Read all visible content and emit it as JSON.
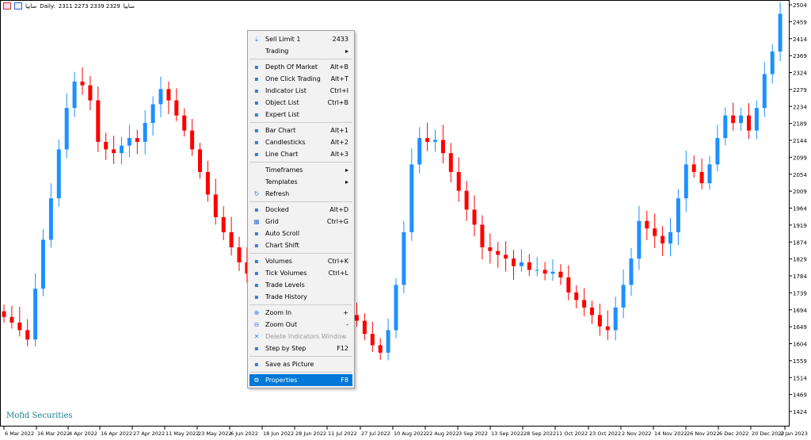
{
  "header": {
    "symbol": "سایپا",
    "timeframe": "Daily:",
    "ohlc": "2311 2273 2339 2329",
    "desc": "سایپا"
  },
  "watermark": "Mofid Securities",
  "colors": {
    "bull": "#1e90ff",
    "bear": "#ff0000",
    "menu_highlight": "#0078d7"
  },
  "y_axis": {
    "ticks": [
      "2504",
      "2459",
      "2414",
      "2369",
      "2324",
      "2279",
      "2234",
      "2189",
      "2144",
      "2099",
      "2054",
      "2009",
      "1964",
      "1919",
      "1874",
      "1829",
      "1784",
      "1739",
      "1694",
      "1649",
      "1604",
      "1559",
      "1514",
      "1469",
      "1424"
    ]
  },
  "x_axis": {
    "ticks": [
      "6 Mar 2022",
      "16 Mar 2022",
      "4 Apr 2022",
      "16 Apr 2022",
      "27 Apr 2022",
      "11 May 2022",
      "23 May 2022",
      "6 Jun 2022",
      "18 Jun 2022",
      "28 Jun 2022",
      "11 Jul 2022",
      "27 Jul 2022",
      "10 Aug 2022",
      "22 Aug 2022",
      "3 Sep 2022",
      "13 Sep 2022",
      "28 Sep 2022",
      "11 Oct 2022",
      "23 Oct 2022",
      "2 Nov 2022",
      "14 Nov 2022",
      "26 Nov 2022",
      "6 Dec 2022",
      "20 Dec 2022",
      "2 Jan 2023"
    ]
  },
  "chart_data": {
    "type": "candlestick",
    "closes": [
      1675,
      1660,
      1640,
      1615,
      1750,
      1880,
      1990,
      2120,
      2230,
      2300,
      2290,
      2250,
      2140,
      2120,
      2110,
      2130,
      2150,
      2140,
      2190,
      2240,
      2280,
      2250,
      2210,
      2170,
      2120,
      2060,
      2000,
      1940,
      1900,
      1860,
      1820,
      1790,
      1780,
      1770,
      1760,
      1750,
      1740,
      1730,
      1720,
      1710,
      1700,
      1700,
      1690,
      1690,
      1680,
      1665,
      1630,
      1600,
      1580,
      1640,
      1760,
      1900,
      2080,
      2150,
      2140,
      2145,
      2110,
      2060,
      2010,
      1960,
      1920,
      1860,
      1850,
      1840,
      1830,
      1810,
      1820,
      1800,
      1800,
      1790,
      1795,
      1780,
      1740,
      1720,
      1700,
      1680,
      1650,
      1640,
      1700,
      1760,
      1830,
      1930,
      1910,
      1890,
      1870,
      1900,
      1990,
      2080,
      2060,
      2030,
      2080,
      2150,
      2210,
      2190,
      2210,
      2170,
      2230,
      2320,
      2380,
      2480
    ],
    "ylim": [
      1424,
      2504
    ]
  },
  "menu": {
    "items": [
      {
        "label": "Sell Limit 1",
        "shortcut": "2433",
        "icon": "sell-limit-icon"
      },
      {
        "label": "Trading",
        "shortcut": "▸",
        "icon": ""
      },
      {
        "label": "Depth Of Market",
        "shortcut": "Alt+B",
        "icon": "depth-of-market-icon"
      },
      {
        "label": "One Click Trading",
        "shortcut": "Alt+T",
        "icon": "one-click-trading-icon"
      },
      {
        "label": "Indicator List",
        "shortcut": "Ctrl+I",
        "icon": "indicator-list-icon"
      },
      {
        "label": "Object List",
        "shortcut": "Ctrl+B",
        "icon": "object-list-icon"
      },
      {
        "label": "Expert List",
        "shortcut": "",
        "icon": "expert-list-icon"
      },
      {
        "label": "Bar Chart",
        "shortcut": "Alt+1",
        "icon": "bar-chart-icon"
      },
      {
        "label": "Candlesticks",
        "shortcut": "Alt+2",
        "icon": "candlesticks-icon"
      },
      {
        "label": "Line Chart",
        "shortcut": "Alt+3",
        "icon": "line-chart-icon"
      },
      {
        "label": "Timeframes",
        "shortcut": "▸",
        "icon": ""
      },
      {
        "label": "Templates",
        "shortcut": "▸",
        "icon": ""
      },
      {
        "label": "Refresh",
        "shortcut": "",
        "icon": "refresh-icon"
      },
      {
        "label": "Docked",
        "shortcut": "Alt+D",
        "icon": "docked-icon"
      },
      {
        "label": "Grid",
        "shortcut": "Ctrl+G",
        "icon": "grid-icon"
      },
      {
        "label": "Auto Scroll",
        "shortcut": "",
        "icon": "auto-scroll-icon"
      },
      {
        "label": "Chart Shift",
        "shortcut": "",
        "icon": "chart-shift-icon"
      },
      {
        "label": "Volumes",
        "shortcut": "Ctrl+K",
        "icon": "volumes-icon"
      },
      {
        "label": "Tick Volumes",
        "shortcut": "Ctrl+L",
        "icon": "tick-volumes-icon"
      },
      {
        "label": "Trade Levels",
        "shortcut": "",
        "icon": "trade-levels-icon"
      },
      {
        "label": "Trade History",
        "shortcut": "",
        "icon": "trade-history-icon"
      },
      {
        "label": "Zoom In",
        "shortcut": "+",
        "icon": "zoom-in-icon"
      },
      {
        "label": "Zoom Out",
        "shortcut": "-",
        "icon": "zoom-out-icon"
      },
      {
        "label": "Delete Indicators Window",
        "shortcut": "",
        "icon": "delete-icon"
      },
      {
        "label": "Step by Step",
        "shortcut": "F12",
        "icon": "step-by-step-icon"
      },
      {
        "label": "Save as Picture",
        "shortcut": "",
        "icon": "save-picture-icon"
      },
      {
        "label": "Properties",
        "shortcut": "F8",
        "icon": "gear-icon"
      }
    ]
  }
}
